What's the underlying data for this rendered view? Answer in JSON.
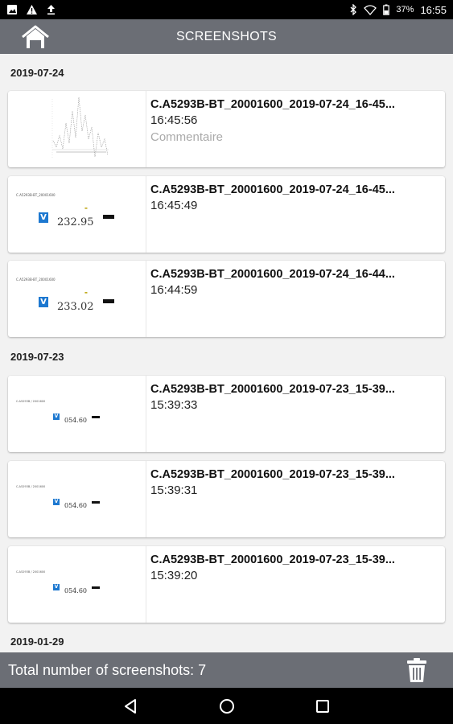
{
  "status_bar": {
    "battery": "37%",
    "time": "16:55"
  },
  "app_bar": {
    "title": "SCREENSHOTS"
  },
  "groups": [
    {
      "date": "2019-07-24",
      "items": [
        {
          "filename": "C.A5293B-BT_20001600_2019-07-24_16-45...",
          "time": "16:45:56",
          "comment": "Commentaire",
          "thumbnail": "graph"
        },
        {
          "filename": "C.A5293B-BT_20001600_2019-07-24_16-45...",
          "time": "16:45:49",
          "comment": "",
          "thumbnail": "meter",
          "thumb_value": "232.95",
          "thumb_unit": "V",
          "thumb_header": "C.A5293B-BT_20001600"
        },
        {
          "filename": "C.A5293B-BT_20001600_2019-07-24_16-44...",
          "time": "16:44:59",
          "comment": "",
          "thumbnail": "meter",
          "thumb_value": "233.02",
          "thumb_unit": "V",
          "thumb_header": "C.A5293B-BT_20001600"
        }
      ]
    },
    {
      "date": "2019-07-23",
      "items": [
        {
          "filename": "C.A5293B-BT_20001600_2019-07-23_15-39...",
          "time": "15:39:33",
          "comment": "",
          "thumbnail": "meter-small",
          "thumb_value": "054.60",
          "thumb_unit": "V",
          "thumb_header": "C.A5293B / 2001600"
        },
        {
          "filename": "C.A5293B-BT_20001600_2019-07-23_15-39...",
          "time": "15:39:31",
          "comment": "",
          "thumbnail": "meter-small",
          "thumb_value": "054.60",
          "thumb_unit": "V",
          "thumb_header": "C.A5293B / 2001600"
        },
        {
          "filename": "C.A5293B-BT_20001600_2019-07-23_15-39...",
          "time": "15:39:20",
          "comment": "",
          "thumbnail": "meter-small",
          "thumb_value": "054.60",
          "thumb_unit": "V",
          "thumb_header": "C.A5293B / 2001600"
        }
      ]
    },
    {
      "date": "2019-01-29",
      "items": []
    }
  ],
  "footer": {
    "total_label": "Total number of screenshots: 7"
  },
  "icons": {
    "home": "home-icon",
    "trash": "trash-icon",
    "back": "back-icon",
    "home_nav": "home-nav-icon",
    "recents": "recents-icon"
  },
  "colors": {
    "app_bar": "#6b6e75",
    "accent_blue": "#1d78d0"
  }
}
